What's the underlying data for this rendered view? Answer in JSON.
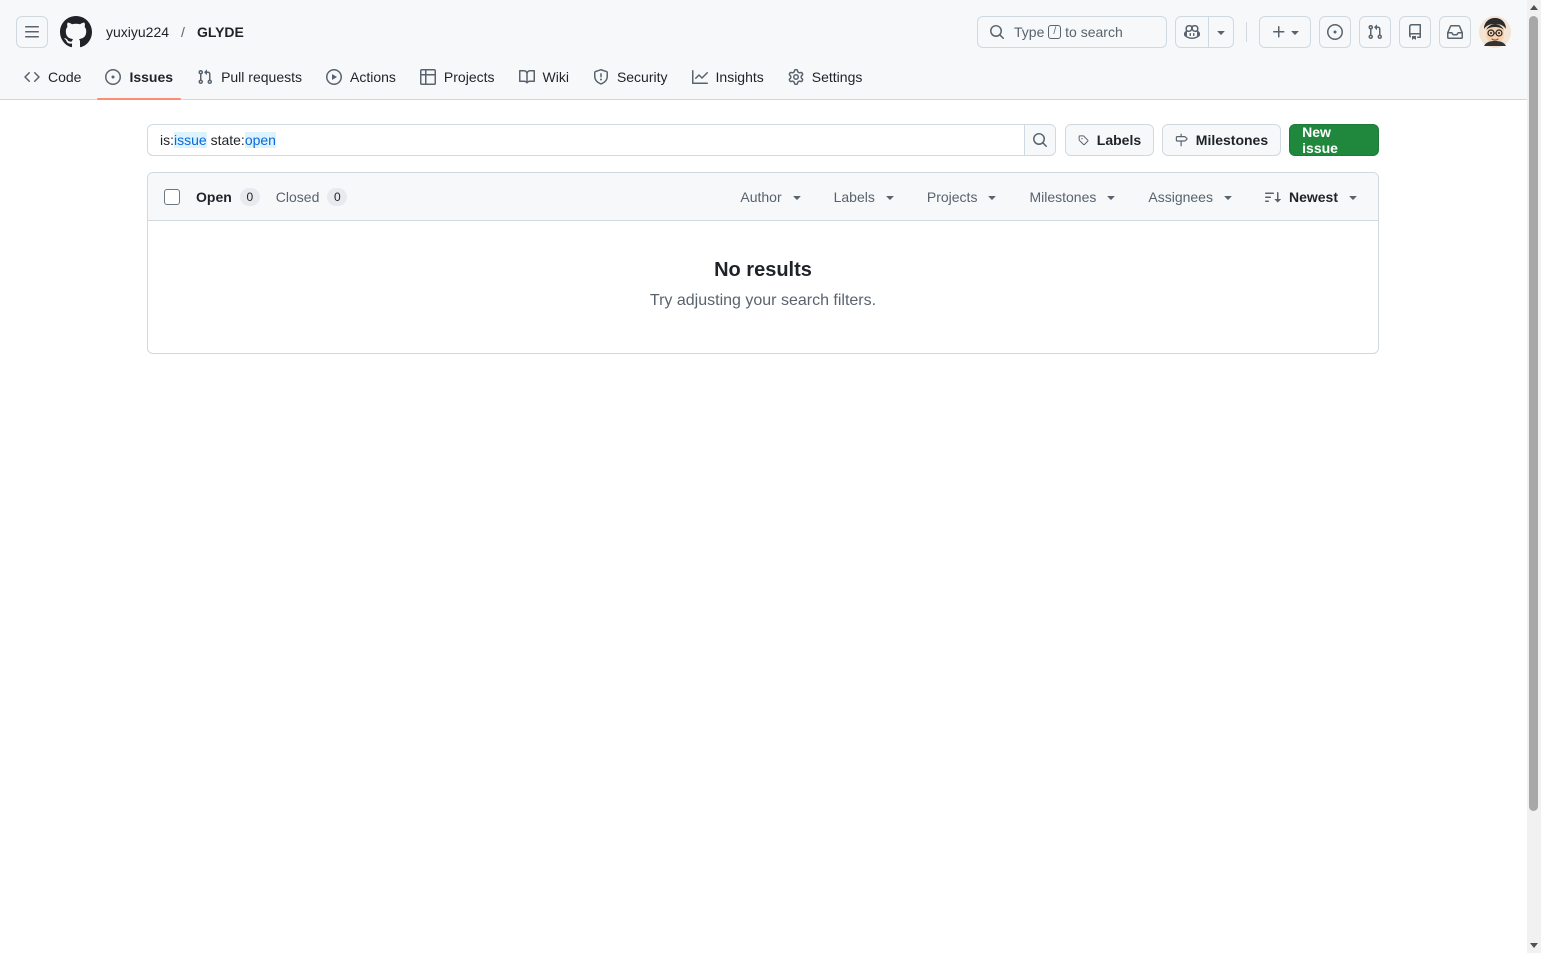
{
  "header": {
    "owner": "yuxiyu224",
    "separator": "/",
    "repo": "GLYDE",
    "search": {
      "prefix": "Type",
      "key": "/",
      "suffix": "to search"
    }
  },
  "nav": {
    "code": "Code",
    "issues": "Issues",
    "pull_requests": "Pull requests",
    "actions": "Actions",
    "projects": "Projects",
    "wiki": "Wiki",
    "security": "Security",
    "insights": "Insights",
    "settings": "Settings"
  },
  "filter": {
    "tokens": [
      {
        "key": "is:",
        "value": "issue"
      },
      {
        "key": "state:",
        "value": "open"
      }
    ]
  },
  "buttons": {
    "labels": "Labels",
    "milestones": "Milestones",
    "new_issue": "New issue"
  },
  "list": {
    "open_label": "Open",
    "open_count": "0",
    "closed_label": "Closed",
    "closed_count": "0",
    "filters": {
      "author": "Author",
      "labels": "Labels",
      "projects": "Projects",
      "milestones": "Milestones",
      "assignees": "Assignees",
      "sort": "Newest"
    }
  },
  "empty": {
    "title": "No results",
    "message": "Try adjusting your search filters."
  },
  "colors": {
    "primary_button": "#1f883d",
    "active_tab_underline": "#fd8c73",
    "filter_token_highlight": "#ddf4ff",
    "filter_token_text": "#0969da"
  }
}
